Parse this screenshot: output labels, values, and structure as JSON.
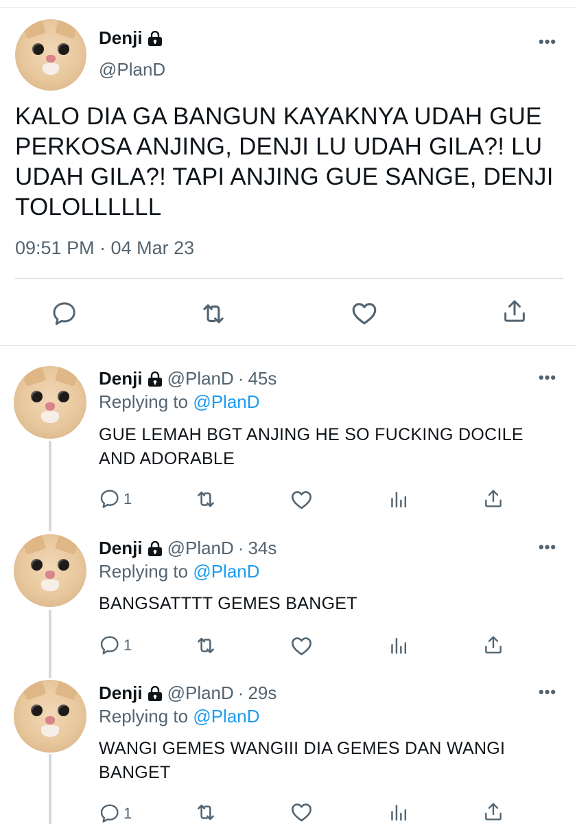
{
  "main_tweet": {
    "author_name": "Denji",
    "author_handle": "@PlanD",
    "text": "KALO DIA GA BANGUN KAYAKNYA UDAH GUE PERKOSA ANJING, DENJI LU UDAH GILA?! LU UDAH GILA?! TAPI ANJING GUE SANGE, DENJI TOLOLLLLLL",
    "timestamp": "09:51 PM · 04 Mar 23",
    "more_label": "•••"
  },
  "replies": [
    {
      "author_name": "Denji",
      "author_handle": "@PlanD",
      "time_ago": "45s",
      "replying_prefix": "Replying to",
      "replying_to": "@PlanD",
      "text": "GUE LEMAH BGT ANJING HE SO FUCKING DOCILE AND ADORABLE",
      "reply_count": "1",
      "more_label": "•••"
    },
    {
      "author_name": "Denji",
      "author_handle": "@PlanD",
      "time_ago": "34s",
      "replying_prefix": "Replying to",
      "replying_to": "@PlanD",
      "text": "BANGSATTTT GEMES BANGET",
      "reply_count": "1",
      "more_label": "•••"
    },
    {
      "author_name": "Denji",
      "author_handle": "@PlanD",
      "time_ago": "29s",
      "replying_prefix": "Replying to",
      "replying_to": "@PlanD",
      "text": "WANGI GEMES WANGIII DIA GEMES DAN WANGI BANGET",
      "reply_count": "1",
      "more_label": "•••"
    }
  ],
  "separator": "·",
  "colors": {
    "text_primary": "#0f1419",
    "text_secondary": "#536471",
    "mention_blue": "#1d9bf0",
    "thread_line": "#cfd9de"
  },
  "icons": [
    "lock-icon",
    "more-icon",
    "reply-icon",
    "retweet-icon",
    "like-icon",
    "share-icon",
    "analytics-icon"
  ]
}
